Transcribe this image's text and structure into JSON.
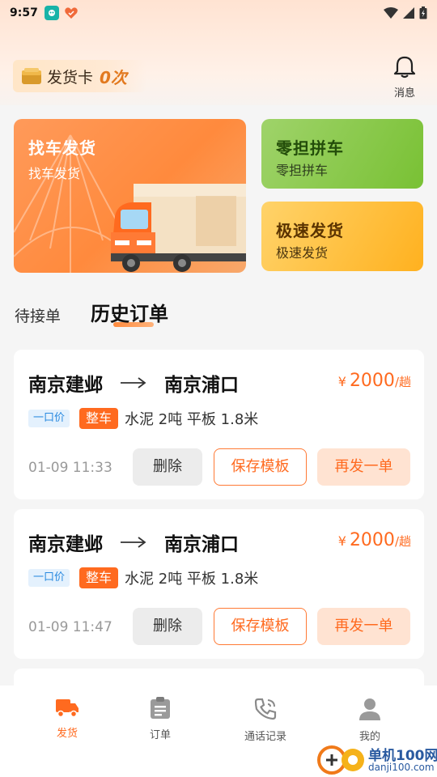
{
  "status_bar": {
    "time": "9:57"
  },
  "header": {
    "card_label": "发货卡",
    "card_count": "0次",
    "message_label": "消息"
  },
  "tiles": {
    "find_truck": {
      "title": "找车发货",
      "subtitle": "找车发货"
    },
    "ltl": {
      "title": "零担拼车",
      "subtitle": "零担拼车"
    },
    "express": {
      "title": "极速发货",
      "subtitle": "极速发货"
    }
  },
  "tabs": {
    "pending": "待接单",
    "history": "历史订单"
  },
  "orders": [
    {
      "from": "南京建邺",
      "to": "南京浦口",
      "currency": "¥",
      "price": "2000",
      "unit": "/趟",
      "price_tag": "一口价",
      "type_tag": "整车",
      "cargo": "水泥 2吨 平板 1.8米",
      "time": "01-09 11:33",
      "delete_label": "删除",
      "save_label": "保存模板",
      "again_label": "再发一单"
    },
    {
      "from": "南京建邺",
      "to": "南京浦口",
      "currency": "¥",
      "price": "2000",
      "unit": "/趟",
      "price_tag": "一口价",
      "type_tag": "整车",
      "cargo": "水泥 2吨 平板 1.8米",
      "time": "01-09 11:47",
      "delete_label": "删除",
      "save_label": "保存模板",
      "again_label": "再发一单"
    }
  ],
  "bottom_nav": [
    {
      "label": "发货",
      "icon": "truck-icon",
      "active": true
    },
    {
      "label": "订单",
      "icon": "clipboard-icon",
      "active": false
    },
    {
      "label": "通话记录",
      "icon": "phone-icon",
      "active": false
    },
    {
      "label": "我的",
      "icon": "person-icon",
      "active": false
    }
  ],
  "watermark": {
    "title": "单机100网",
    "url": "danji100.com"
  },
  "colors": {
    "accent": "#ff6a1f",
    "green_tile": "#79c134",
    "yellow_tile": "#ffb11f",
    "price_tag": "#2a8ae0"
  }
}
